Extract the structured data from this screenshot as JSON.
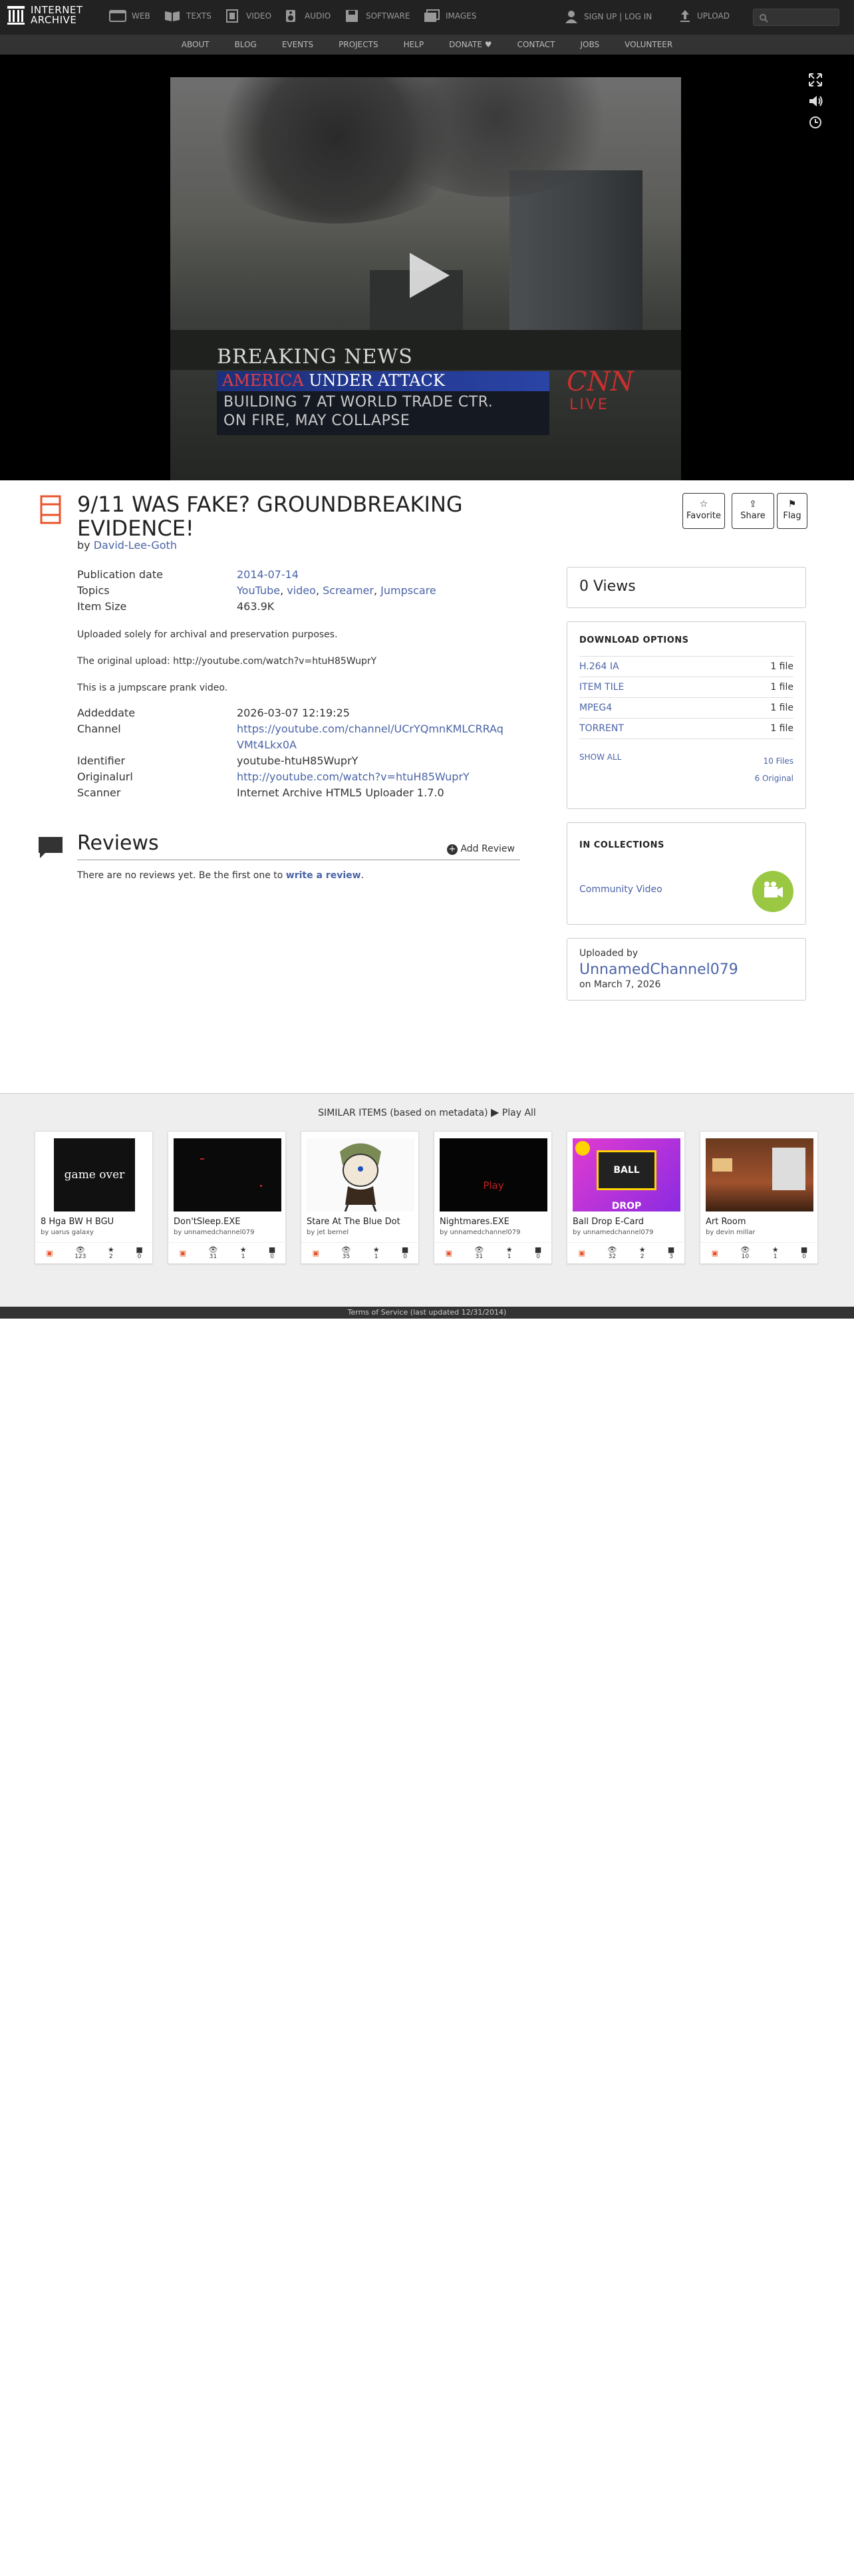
{
  "nav": {
    "logo_line1": "INTERNET",
    "logo_line2": "ARCHIVE",
    "items": [
      {
        "label": "WEB",
        "icon": "web-icon"
      },
      {
        "label": "TEXTS",
        "icon": "book-icon"
      },
      {
        "label": "VIDEO",
        "icon": "film-icon"
      },
      {
        "label": "AUDIO",
        "icon": "speaker-icon"
      },
      {
        "label": "SOFTWARE",
        "icon": "floppy-icon"
      },
      {
        "label": "IMAGES",
        "icon": "images-icon"
      }
    ],
    "signup": "SIGN UP | LOG IN",
    "upload": "UPLOAD"
  },
  "subnav": [
    "ABOUT",
    "BLOG",
    "EVENTS",
    "PROJECTS",
    "HELP",
    "DONATE",
    "CONTACT",
    "JOBS",
    "VOLUNTEER"
  ],
  "video": {
    "breaking": "BREAKING NEWS",
    "america_red": "AMERICA",
    "america_white": " UNDER ATTACK",
    "line1": "BUILDING 7 AT WORLD TRADE CTR.",
    "line2": "ON FIRE, MAY COLLAPSE",
    "cnn": "CNN",
    "live": "LIVE"
  },
  "item": {
    "title": "9/11 WAS FAKE? GROUNDBREAKING EVIDENCE!",
    "by": "by",
    "author": "David-Lee-Goth",
    "actions": {
      "favorite": "Favorite",
      "share": "Share",
      "flag": "Flag"
    }
  },
  "metadata": {
    "pubdate_label": "Publication date",
    "pubdate": "2014-07-14",
    "topics_label": "Topics",
    "topics": [
      "YouTube",
      "video",
      "Screamer",
      "Jumpscare"
    ],
    "size_label": "Item Size",
    "size": "463.9K",
    "desc1": "Uploaded solely for archival and preservation purposes.",
    "desc2": "The original upload: http://youtube.com/watch?v=htuH85WuprY",
    "desc3": "This is a jumpscare prank video.",
    "addeddate_label": "Addeddate",
    "addeddate": "2026-03-07 12:19:25",
    "channel_label": "Channel",
    "channel_1": "https://youtube.com/channel/UCrYQmnKMLCRRAq",
    "channel_2": "VMt4Lkx0A",
    "identifier_label": "Identifier",
    "identifier": "youtube-htuH85WuprY",
    "originalurl_label": "Originalurl",
    "originalurl": "http://youtube.com/watch?v=htuH85WuprY",
    "scanner_label": "Scanner",
    "scanner": "Internet Archive HTML5 Uploader 1.7.0"
  },
  "reviews": {
    "heading": "Reviews",
    "add": "Add Review",
    "empty_prefix": "There are no reviews yet. Be the first one to ",
    "empty_link": "write a review",
    "empty_suffix": "."
  },
  "sidebar": {
    "views": "0 Views",
    "download_heading": "DOWNLOAD OPTIONS",
    "downloads": [
      {
        "name": "H.264 IA",
        "count": "1 file"
      },
      {
        "name": "ITEM TILE",
        "count": "1 file"
      },
      {
        "name": "MPEG4",
        "count": "1 file"
      },
      {
        "name": "TORRENT",
        "count": "1 file"
      }
    ],
    "show_all": "SHOW ALL",
    "files": "10 Files",
    "original": "6 Original",
    "collections_heading": "IN COLLECTIONS",
    "collection": "Community Video",
    "uploaded_by": "Uploaded by",
    "uploader": "UnnamedChannel079",
    "uploaded_on": "on March 7, 2026"
  },
  "similar": {
    "heading": "SIMILAR ITEMS (based on metadata)",
    "play_all": "Play All",
    "items": [
      {
        "title": "8 Hga BW H BGU",
        "by": "by uarus galaxy",
        "views": "123",
        "favs": "2",
        "reviews": "0",
        "img_text": "game over"
      },
      {
        "title": "Don'tSleep.EXE",
        "by": "by unnamedchannel079",
        "views": "31",
        "favs": "1",
        "reviews": "0",
        "img_text": ""
      },
      {
        "title": "Stare At The Blue Dot",
        "by": "by jet bernel",
        "views": "35",
        "favs": "1",
        "reviews": "0",
        "img_text": ""
      },
      {
        "title": "Nightmares.EXE",
        "by": "by unnamedchannel079",
        "views": "31",
        "favs": "1",
        "reviews": "0",
        "img_text": "Play"
      },
      {
        "title": "Ball Drop E-Card",
        "by": "by unnamedchannel079",
        "views": "32",
        "favs": "2",
        "reviews": "3",
        "img_text": "BALL DROP"
      },
      {
        "title": "Art Room",
        "by": "by devin millar",
        "views": "10",
        "favs": "1",
        "reviews": "0",
        "img_text": ""
      }
    ]
  },
  "footer": "Terms of Service (last updated 12/31/2014)"
}
